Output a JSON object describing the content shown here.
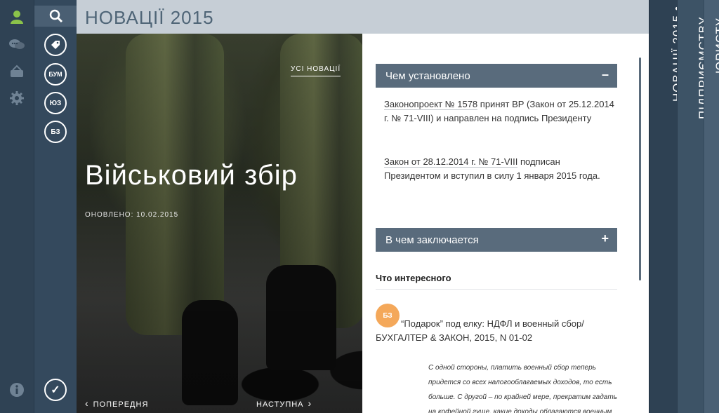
{
  "header": {
    "title": "НОВАЦІЇ 2015"
  },
  "hero": {
    "all_news_link": "УСІ НОВАЦІЇ",
    "title": "Військовий збір",
    "updated": "ОНОВЛЕНО: 10.02.2015",
    "prev_label": "ПОПЕРЕДНЯ",
    "next_label": "НАСТУПНА"
  },
  "nav2": {
    "circle_items": [
      {
        "label": ""
      },
      {
        "label": "БУМ"
      },
      {
        "label": "ЮЗ"
      },
      {
        "label": "БЗ"
      }
    ],
    "check_label": "✓"
  },
  "article": {
    "section1": {
      "title": "Чем установлено",
      "toggle": "–",
      "p1_link": "Законопроект № 1578",
      "p1_text": " принят ВР (Закон от 25.12.2014 г. № 71-VIII) и направлен на подпись Президенту",
      "p2_link": "Закон от 28.12.2014 г. № 71-VIII",
      "p2_text": " подписан Президентом и вступил в силу 1 января 2015 года."
    },
    "section2": {
      "title": "В чем заключается",
      "toggle": "+"
    },
    "interesting_title": "Что интересного",
    "badge": "БЗ",
    "link_title": "“Подарок” под елку: НДФЛ и военный сбор",
    "link_source": "/БУХГАЛТЕР & ЗАКОН, 2015, N 01-02",
    "quote": "С одной стороны, платить военный сбор теперь придется со всех налогооблагаемых доходов, то есть больше. С другой – по крайней мере, прекратим гадать на кофейной гуще, какие доходы облагаются военным"
  },
  "right_tabs": [
    {
      "label": "НОВАЦІЇ 2015 •"
    },
    {
      "label": "ПІДПРИЄМСТВУ"
    },
    {
      "label": "ЮРИСТУ"
    }
  ],
  "colors": {
    "accordion": "#596b7c",
    "badge": "#f4a85a",
    "user_icon": "#8bc34a",
    "header_bg": "#c6ced6"
  }
}
